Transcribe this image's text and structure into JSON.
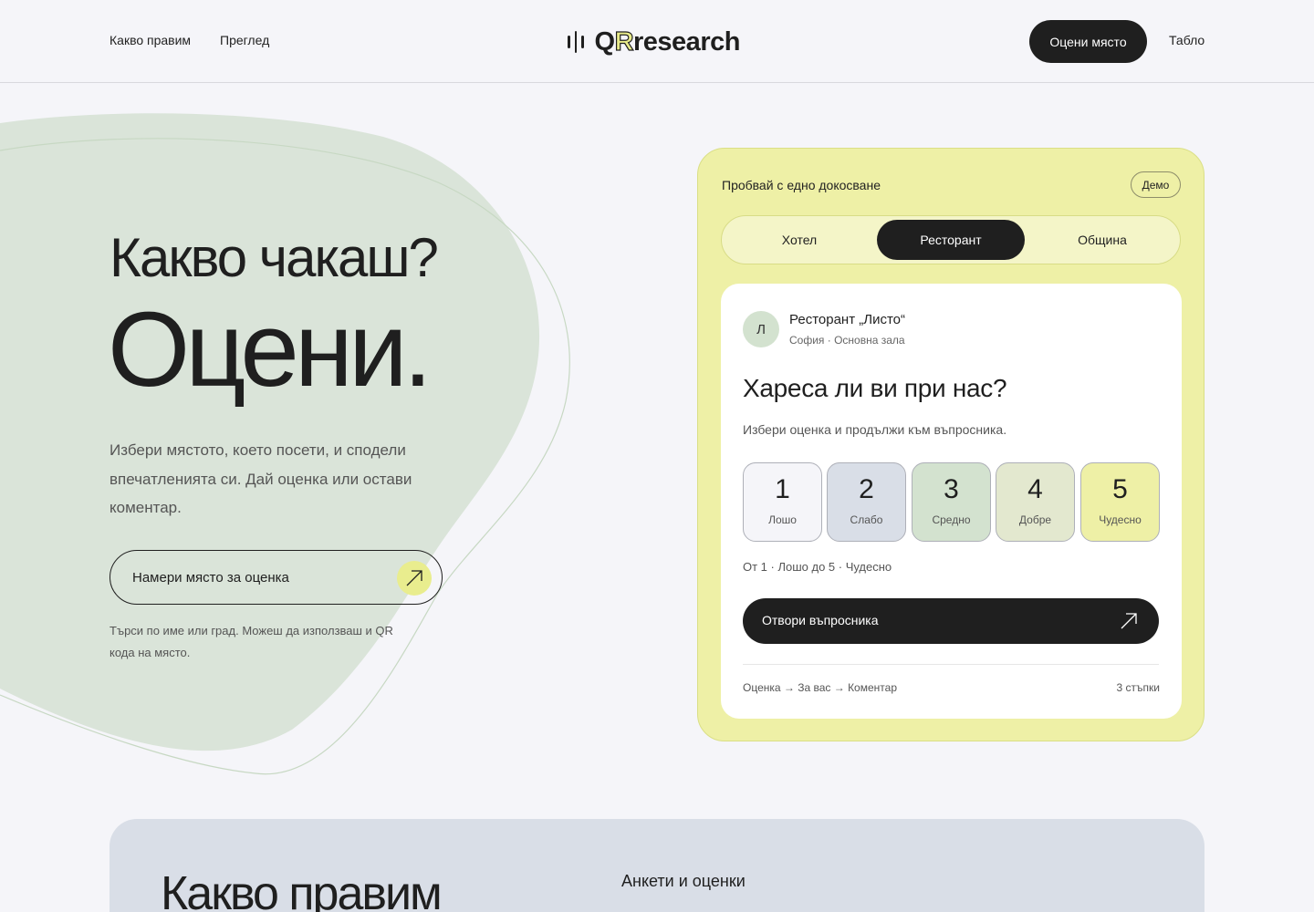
{
  "header": {
    "nav": [
      "Какво правим",
      "Преглед"
    ],
    "logo_q": "Q",
    "logo_r": "R",
    "logo_rest": "research",
    "rate_button": "Оцени място",
    "dashboard_link": "Табло"
  },
  "hero": {
    "question": "Какво чакаш?",
    "headline": "Оцени.",
    "description": "Избери мястото, което посети, и сподели впечатленията си. Дай оценка или остави коментар.",
    "search_button": "Намери място за оценка",
    "hint": "Търси по име или град. Можеш да използваш и QR кода на място."
  },
  "demo": {
    "title": "Пробвай с едно докосване",
    "badge": "Демо",
    "tabs": [
      "Хотел",
      "Ресторант",
      "Община"
    ],
    "active_tab": "Ресторант",
    "place": {
      "avatar": "Л",
      "name": "Ресторант „Листо“",
      "location": "София · Основна зала"
    },
    "question": "Хареса ли ви при нас?",
    "instruction": "Избери оценка и продължи към въпросника.",
    "ratings": [
      {
        "value": "1",
        "label": "Лошо",
        "color": "#f5f5f9"
      },
      {
        "value": "2",
        "label": "Слабо",
        "color": "#d9dee7"
      },
      {
        "value": "3",
        "label": "Средно",
        "color": "#d3e2cf"
      },
      {
        "value": "4",
        "label": "Добре",
        "color": "#e3e8cf"
      },
      {
        "value": "5",
        "label": "Чудесно",
        "color": "#eef0a6"
      }
    ],
    "range_text": "От 1 · Лошо до 5 · Чудесно",
    "open_button": "Отвори въпросника",
    "steps": "Оценка → За вас → Коментар",
    "steps_count": "3 стъпки"
  },
  "section": {
    "title": "Какво правим",
    "subtitle": "Анкети и оценки"
  },
  "colors": {
    "accent_yellow": "#eef0a6",
    "accent_green": "#d3e2cf",
    "accent_blue": "#d9dee7",
    "dark": "#1f1f1f"
  }
}
